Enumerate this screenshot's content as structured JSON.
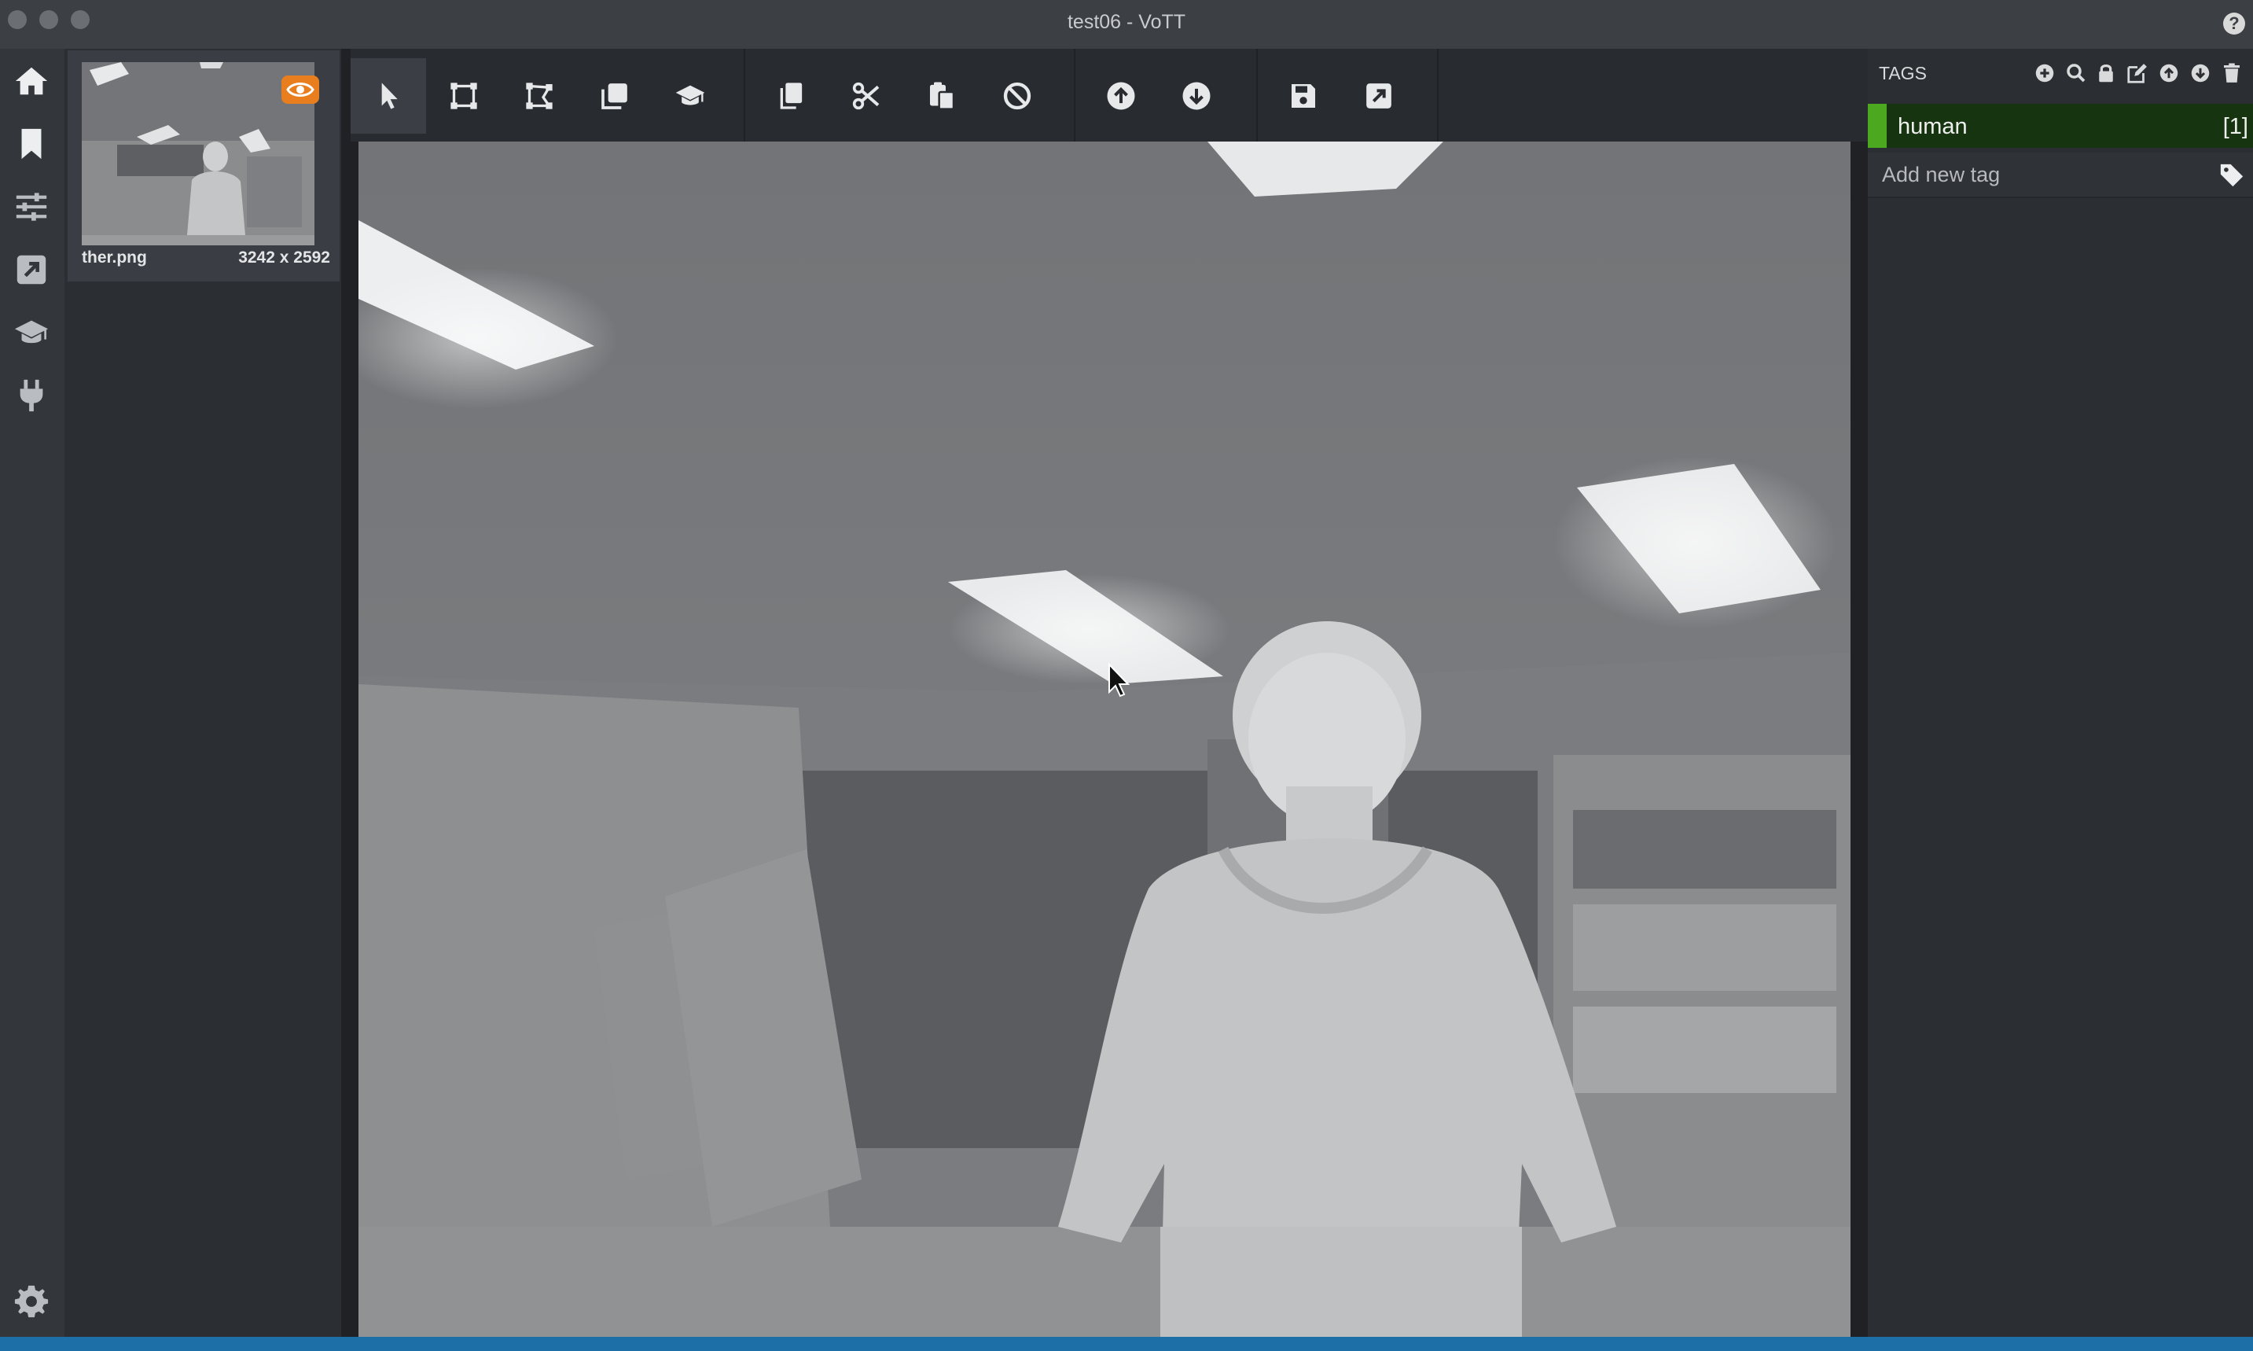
{
  "window": {
    "title": "test06 - VoTT"
  },
  "nav": {
    "items": [
      {
        "id": "home",
        "icon": "home-icon"
      },
      {
        "id": "editor",
        "icon": "bookmark-icon"
      },
      {
        "id": "settings",
        "icon": "sliders-icon"
      },
      {
        "id": "export",
        "icon": "export-icon"
      },
      {
        "id": "active-learning",
        "icon": "graduation-cap-icon"
      },
      {
        "id": "connections",
        "icon": "plug-icon"
      }
    ],
    "app_settings_icon": "gear-icon"
  },
  "assets": [
    {
      "name": "ther.png",
      "size": "3242 x 2592",
      "visited": true
    }
  ],
  "toolbar": {
    "tools": [
      {
        "id": "select",
        "icon": "pointer-icon",
        "active": true
      },
      {
        "id": "draw-rectangle",
        "icon": "rectangle-icon"
      },
      {
        "id": "draw-polygon",
        "icon": "polygon-icon"
      },
      {
        "id": "copy-rectangle",
        "icon": "copy-rectangle-icon"
      },
      {
        "id": "active-learning",
        "icon": "graduation-cap-icon"
      },
      {
        "id": "copy",
        "icon": "copy-icon"
      },
      {
        "id": "cut",
        "icon": "scissors-icon"
      },
      {
        "id": "paste",
        "icon": "paste-icon"
      },
      {
        "id": "remove-all",
        "icon": "ban-icon"
      },
      {
        "id": "previous-asset",
        "icon": "arrow-up-icon"
      },
      {
        "id": "next-asset",
        "icon": "arrow-down-icon"
      },
      {
        "id": "save",
        "icon": "save-icon"
      },
      {
        "id": "export",
        "icon": "export-icon"
      }
    ]
  },
  "tags_panel": {
    "title": "TAGS",
    "tags": [
      {
        "name": "human",
        "count": "[1]",
        "color": "#4ca81f"
      }
    ],
    "add_tag_placeholder": "Add new tag"
  }
}
